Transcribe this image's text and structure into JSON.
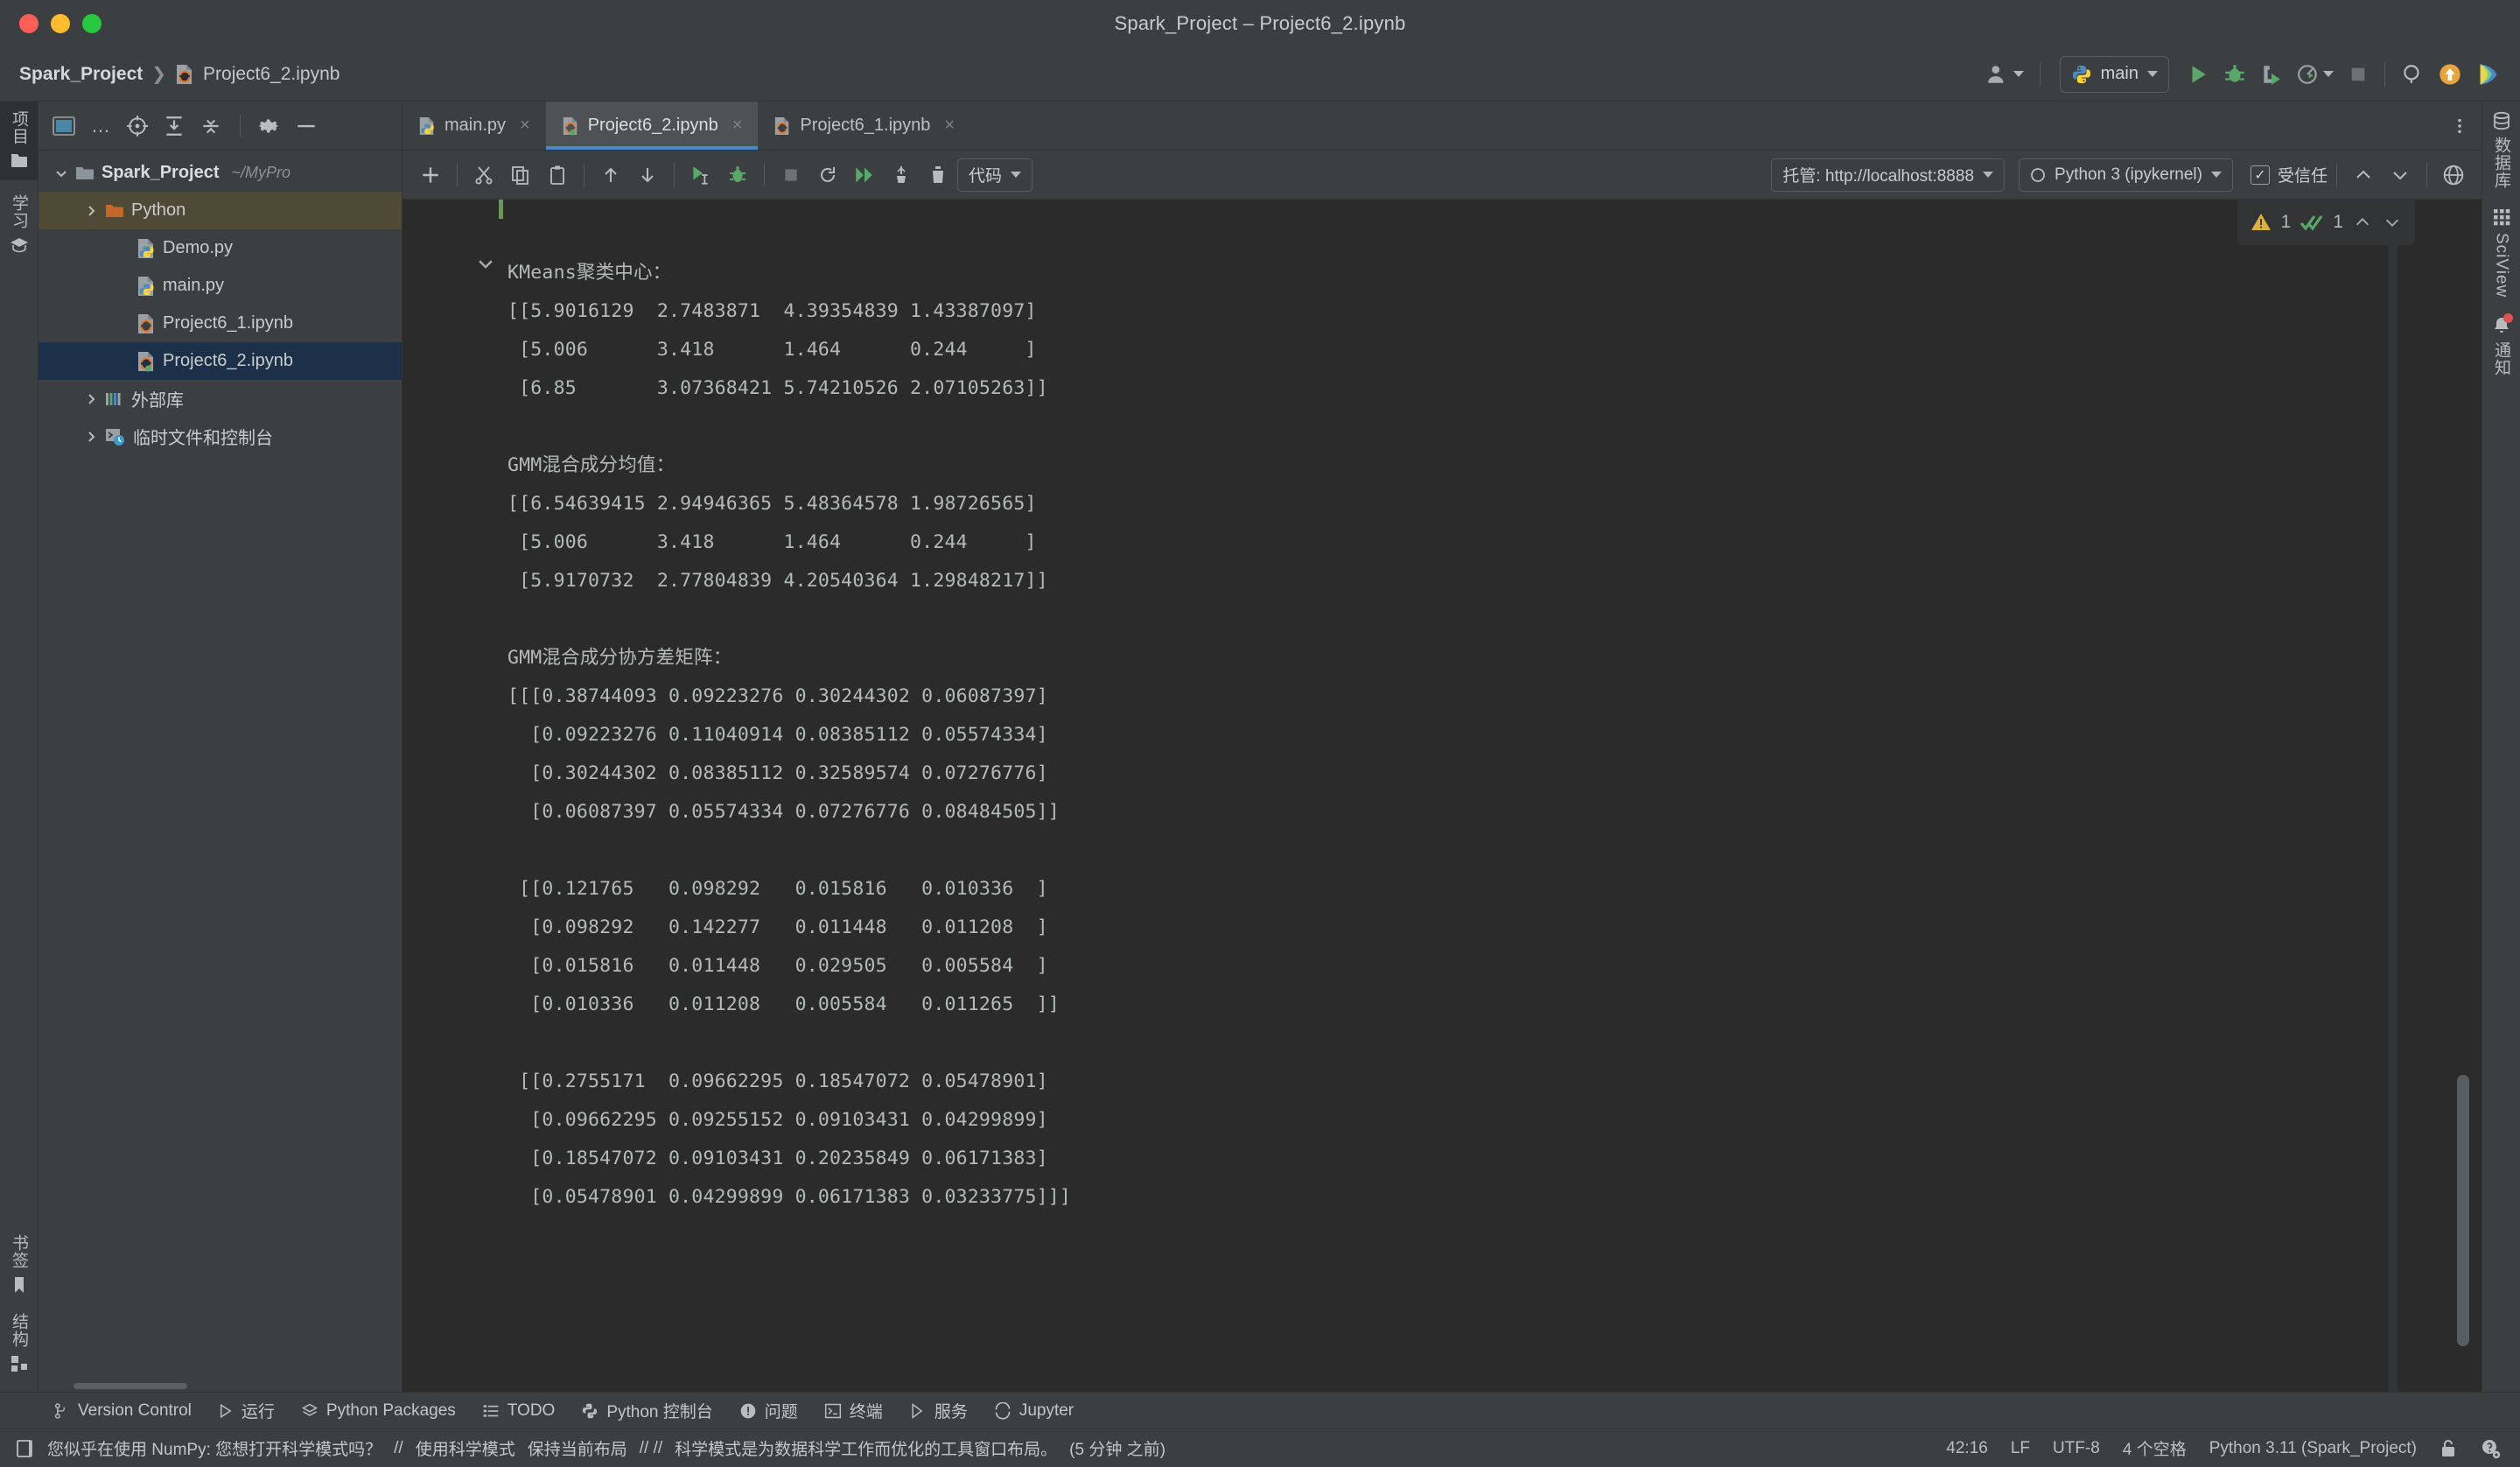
{
  "window": {
    "title": "Spark_Project – Project6_2.ipynb",
    "traffic": [
      "close",
      "minimize",
      "zoom"
    ]
  },
  "breadcrumb": {
    "project": "Spark_Project",
    "separator": "❯",
    "file": "Project6_2.ipynb"
  },
  "main_toolbar": {
    "run_config": "main",
    "icons": [
      "account-icon",
      "python-icon",
      "run-icon",
      "debug-icon",
      "run-coverage-icon",
      "profile-icon",
      "stop-icon",
      "search-icon",
      "update-icon",
      "ai-assistant-icon"
    ]
  },
  "rail_left": {
    "top": [
      {
        "name": "project-tool-window",
        "label": "项目",
        "icon": "project-icon",
        "active": true
      },
      {
        "name": "commit-tool-window",
        "label": "",
        "icon": "folder-icon",
        "active": true
      }
    ],
    "middle": [
      {
        "name": "learn-tool-window",
        "label": "学习",
        "icon": "learn-icon"
      },
      {
        "name": "plugins-tool-window",
        "label": "",
        "icon": "graduation-icon"
      }
    ],
    "bottom": [
      {
        "name": "bookmarks-tool-window",
        "label": "书签",
        "icon": "bookmark-icon"
      },
      {
        "name": "structure-tool-window",
        "label": "结构",
        "icon": "structure-icon"
      }
    ]
  },
  "rail_right": [
    {
      "name": "database-tool-window",
      "label": "数据库",
      "icon": "database-icon"
    },
    {
      "name": "sciview-tool-window",
      "label": "SciView",
      "icon": "grid-icon"
    },
    {
      "name": "notifications-tool-window",
      "label": "通知",
      "icon": "bell-icon",
      "badge": true
    }
  ],
  "project_panel": {
    "toolbar_icons": [
      "window-mode-icon",
      "more-icon",
      "select-opened-file-icon",
      "expand-all-icon",
      "collapse-all-icon",
      "settings-icon",
      "hide-icon"
    ],
    "tree": [
      {
        "label": "Spark_Project",
        "path": "~/MyPro",
        "icon": "folder-icon",
        "depth": 0,
        "arrow": "down",
        "bold": true,
        "state": "normal"
      },
      {
        "label": "Python",
        "path": "",
        "icon": "folder-orange-icon",
        "depth": 1,
        "arrow": "right",
        "bold": false,
        "state": "highlight"
      },
      {
        "label": "Demo.py",
        "path": "",
        "icon": "python-file-icon",
        "depth": 2,
        "arrow": "none",
        "bold": false,
        "state": "normal"
      },
      {
        "label": "main.py",
        "path": "",
        "icon": "python-file-icon",
        "depth": 2,
        "arrow": "none",
        "bold": false,
        "state": "normal"
      },
      {
        "label": "Project6_1.ipynb",
        "path": "",
        "icon": "jupyter-file-icon",
        "depth": 2,
        "arrow": "none",
        "bold": false,
        "state": "normal"
      },
      {
        "label": "Project6_2.ipynb",
        "path": "",
        "icon": "jupyter-running-icon",
        "depth": 2,
        "arrow": "none",
        "bold": false,
        "state": "selected"
      },
      {
        "label": "外部库",
        "path": "",
        "icon": "library-icon",
        "depth": 1,
        "arrow": "right",
        "bold": false,
        "state": "normal"
      },
      {
        "label": "临时文件和控制台",
        "path": "",
        "icon": "scratches-icon",
        "depth": 1,
        "arrow": "right",
        "bold": false,
        "state": "normal"
      }
    ]
  },
  "tabs": [
    {
      "label": "main.py",
      "icon": "python-file-icon",
      "active": false,
      "close": "×"
    },
    {
      "label": "Project6_2.ipynb",
      "icon": "jupyter-running-icon",
      "active": true,
      "close": "×"
    },
    {
      "label": "Project6_1.ipynb",
      "icon": "jupyter-file-icon",
      "active": false,
      "close": "×"
    }
  ],
  "notebook_toolbar": {
    "icons": [
      "add-cell-icon",
      "cut-icon",
      "copy-icon",
      "paste-icon",
      "move-up-icon",
      "move-down-icon",
      "run-cell-icon",
      "debug-cell-icon",
      "interrupt-icon",
      "restart-kernel-icon",
      "run-all-icon",
      "clear-outputs-icon",
      "delete-cell-icon"
    ],
    "cell_type": "代码",
    "server": "托管: http://localhost:8888",
    "kernel": "Python 3 (ipykernel)",
    "trusted_label": "受信任",
    "trusted_checked": true,
    "nav_icons": [
      "prev-cell-icon",
      "next-cell-icon",
      "browser-icon"
    ]
  },
  "inspection_widget": {
    "warning_count": "1",
    "ok_count": "1",
    "icons": [
      "warning-icon",
      "checkmark-icon",
      "prev-problem-icon",
      "next-problem-icon"
    ]
  },
  "output": {
    "blocks": [
      {
        "title": "KMeans聚类中心：",
        "lines": [
          "[[5.9016129  2.7483871  4.39354839 1.43387097]",
          " [5.006      3.418      1.464      0.244     ]",
          " [6.85       3.07368421 5.74210526 2.07105263]]"
        ]
      },
      {
        "title": "GMM混合成分均值：",
        "lines": [
          "[[6.54639415 2.94946365 5.48364578 1.98726565]",
          " [5.006      3.418      1.464      0.244     ]",
          " [5.9170732  2.77804839 4.20540364 1.29848217]]"
        ]
      },
      {
        "title": "GMM混合成分协方差矩阵：",
        "lines": [
          "[[[0.38744093 0.09223276 0.30244302 0.06087397]",
          "  [0.09223276 0.11040914 0.08385112 0.05574334]",
          "  [0.30244302 0.08385112 0.32589574 0.07276776]",
          "  [0.06087397 0.05574334 0.07276776 0.08484505]]",
          "",
          " [[0.121765   0.098292   0.015816   0.010336  ]",
          "  [0.098292   0.142277   0.011448   0.011208  ]",
          "  [0.015816   0.011448   0.029505   0.005584  ]",
          "  [0.010336   0.011208   0.005584   0.011265  ]]",
          "",
          " [[0.2755171  0.09662295 0.18547072 0.05478901]",
          "  [0.09662295 0.09255152 0.09103431 0.04299899]",
          "  [0.18547072 0.09103431 0.20235849 0.06171383]",
          "  [0.05478901 0.04299899 0.06171383 0.03233775]]]"
        ]
      }
    ]
  },
  "tool_windows": [
    {
      "label": "Version Control",
      "icon": "vcs-icon"
    },
    {
      "label": "运行",
      "icon": "run-icon"
    },
    {
      "label": "Python Packages",
      "icon": "packages-icon"
    },
    {
      "label": "TODO",
      "icon": "todo-icon"
    },
    {
      "label": "Python 控制台",
      "icon": "python-console-icon"
    },
    {
      "label": "问题",
      "icon": "problems-icon"
    },
    {
      "label": "终端",
      "icon": "terminal-icon"
    },
    {
      "label": "服务",
      "icon": "services-icon"
    },
    {
      "label": "Jupyter",
      "icon": "jupyter-icon"
    }
  ],
  "status_bar": {
    "icon": "notification-icon",
    "message": "您似乎在使用 NumPy: 您想打开科学模式吗？",
    "sep1": "//",
    "action1": "使用科学模式",
    "action2": "保持当前布局",
    "sep2": "// //",
    "note": "科学模式是为数据科学工作而优化的工具窗口布局。",
    "timestamp": "(5 分钟 之前)",
    "caret_position": "42:16",
    "line_separator": "LF",
    "encoding": "UTF-8",
    "indent": "4 个空格",
    "interpreter": "Python 3.11 (Spark_Project)",
    "right_icons": [
      "lock-icon",
      "inspection-settings-icon"
    ]
  },
  "colors": {
    "chrome": "#3c3f41",
    "editor_bg": "#2b2b2b",
    "selection": "#1c3049",
    "accent_blue": "#4a88c7",
    "green": "#6a9955",
    "orange": "#cc7832",
    "warning": "#d9b13b"
  }
}
